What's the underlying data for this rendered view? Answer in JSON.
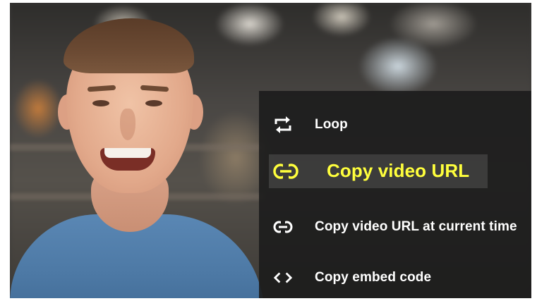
{
  "video": {
    "context_menu": {
      "items": [
        {
          "label": "Loop",
          "icon": "loop-icon"
        },
        {
          "label": "Copy video URL",
          "icon": "link-icon",
          "highlighted": true
        },
        {
          "label": "Copy video URL at current time",
          "icon": "link-icon"
        },
        {
          "label": "Copy embed code",
          "icon": "embed-code-icon"
        }
      ]
    }
  },
  "colors": {
    "menu_background": "#1c1c1c",
    "menu_text": "#ffffff",
    "highlight_text": "#ffff3c",
    "shirt": "#4d79a5"
  }
}
